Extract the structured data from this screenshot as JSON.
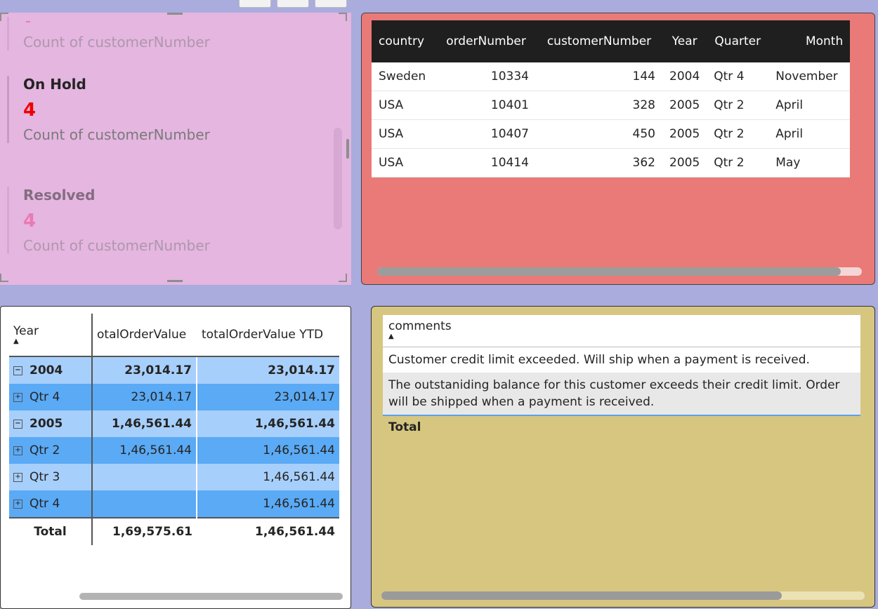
{
  "cards": [
    {
      "title": "",
      "value": "",
      "label": "Count of customerNumber",
      "color": "#a0a0a0",
      "dim": true
    },
    {
      "title": "On Hold",
      "value": "4",
      "label": "Count of customerNumber",
      "color": "#ee0000",
      "dim": false
    },
    {
      "title": "Resolved",
      "value": "4",
      "label": "Count of customerNumber",
      "color": "#f0408a",
      "dim": true
    }
  ],
  "orders_table": {
    "columns": [
      "country",
      "orderNumber",
      "customerNumber",
      "Year",
      "Quarter",
      "Month"
    ],
    "rows": [
      [
        "Sweden",
        "10334",
        "144",
        "2004",
        "Qtr 4",
        "November"
      ],
      [
        "USA",
        "10401",
        "328",
        "2005",
        "Qtr 2",
        "April"
      ],
      [
        "USA",
        "10407",
        "450",
        "2005",
        "Qtr 2",
        "April"
      ],
      [
        "USA",
        "10414",
        "362",
        "2005",
        "Qtr 2",
        "May"
      ]
    ]
  },
  "matrix": {
    "columns": [
      "Year",
      "otalOrderValue",
      "totalOrderValue YTD"
    ],
    "rows": [
      {
        "label": "2004",
        "level": 0,
        "toggle": "minus",
        "value": "23,014.17",
        "ytd": "23,014.17",
        "shade": "light"
      },
      {
        "label": "Qtr 4",
        "level": 1,
        "toggle": "plus",
        "value": "23,014.17",
        "ytd": "23,014.17",
        "shade": "dark"
      },
      {
        "label": "2005",
        "level": 0,
        "toggle": "minus",
        "value": "1,46,561.44",
        "ytd": "1,46,561.44",
        "shade": "light"
      },
      {
        "label": "Qtr 2",
        "level": 1,
        "toggle": "plus",
        "value": "1,46,561.44",
        "ytd": "1,46,561.44",
        "shade": "dark"
      },
      {
        "label": "Qtr 3",
        "level": 1,
        "toggle": "plus",
        "value": "",
        "ytd": "1,46,561.44",
        "shade": "light"
      },
      {
        "label": "Qtr 4",
        "level": 1,
        "toggle": "plus",
        "value": "",
        "ytd": "1,46,561.44",
        "shade": "dark"
      }
    ],
    "total": {
      "label": "Total",
      "value": "1,69,575.61",
      "ytd": "1,46,561.44"
    }
  },
  "comments": {
    "column": "comments",
    "rows": [
      "Customer credit limit exceeded. Will ship when a payment is received.",
      "The outstaniding balance for this customer exceeds their credit limit. Order will be shipped when a payment is received."
    ],
    "total": "Total"
  }
}
